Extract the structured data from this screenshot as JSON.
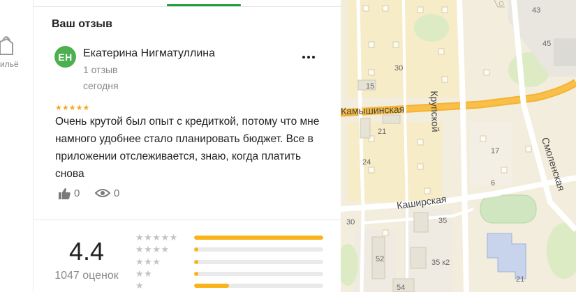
{
  "sidebar": {
    "partial_label": "ильё",
    "icon": "bag-icon"
  },
  "review_section": {
    "title": "Ваш отзыв",
    "author": {
      "initials": "ЕН",
      "name": "Екатерина Нигматуллина",
      "reviews_count": "1 отзыв",
      "date": "сегодня",
      "avatar_color": "#4caf50"
    },
    "rating_stars": 5,
    "stars_text": "★★★★★",
    "text": "Очень крутой был опыт с кредиткой, потому что мне намного удобнее стало планировать бюджет. Все в приложении отслеживается, знаю, когда платить снова",
    "likes": "0",
    "views": "0",
    "more_icon": "more-dots-icon"
  },
  "rating_summary": {
    "value": "4.4",
    "count": "1047 оценок",
    "distribution": [
      {
        "stars": "★★★★★",
        "fraction": 1.0
      },
      {
        "stars": "★★★★",
        "fraction": 0.035
      },
      {
        "stars": "★★★",
        "fraction": 0.035
      },
      {
        "stars": "★★",
        "fraction": 0.035
      },
      {
        "stars": "★",
        "fraction": 0.27
      }
    ],
    "accent_color": "#f9b41a"
  },
  "map": {
    "streets": {
      "kamyshinskaya": "Камышинская",
      "krupskoy": "Крупской",
      "smolenskaya": "Смоленская",
      "kashirskaya": "Каширская"
    },
    "house_numbers": [
      "43",
      "45",
      "30",
      "15",
      "21",
      "17",
      "24",
      "6",
      "30",
      "35",
      "52",
      "35 к2",
      "54",
      "21"
    ]
  }
}
